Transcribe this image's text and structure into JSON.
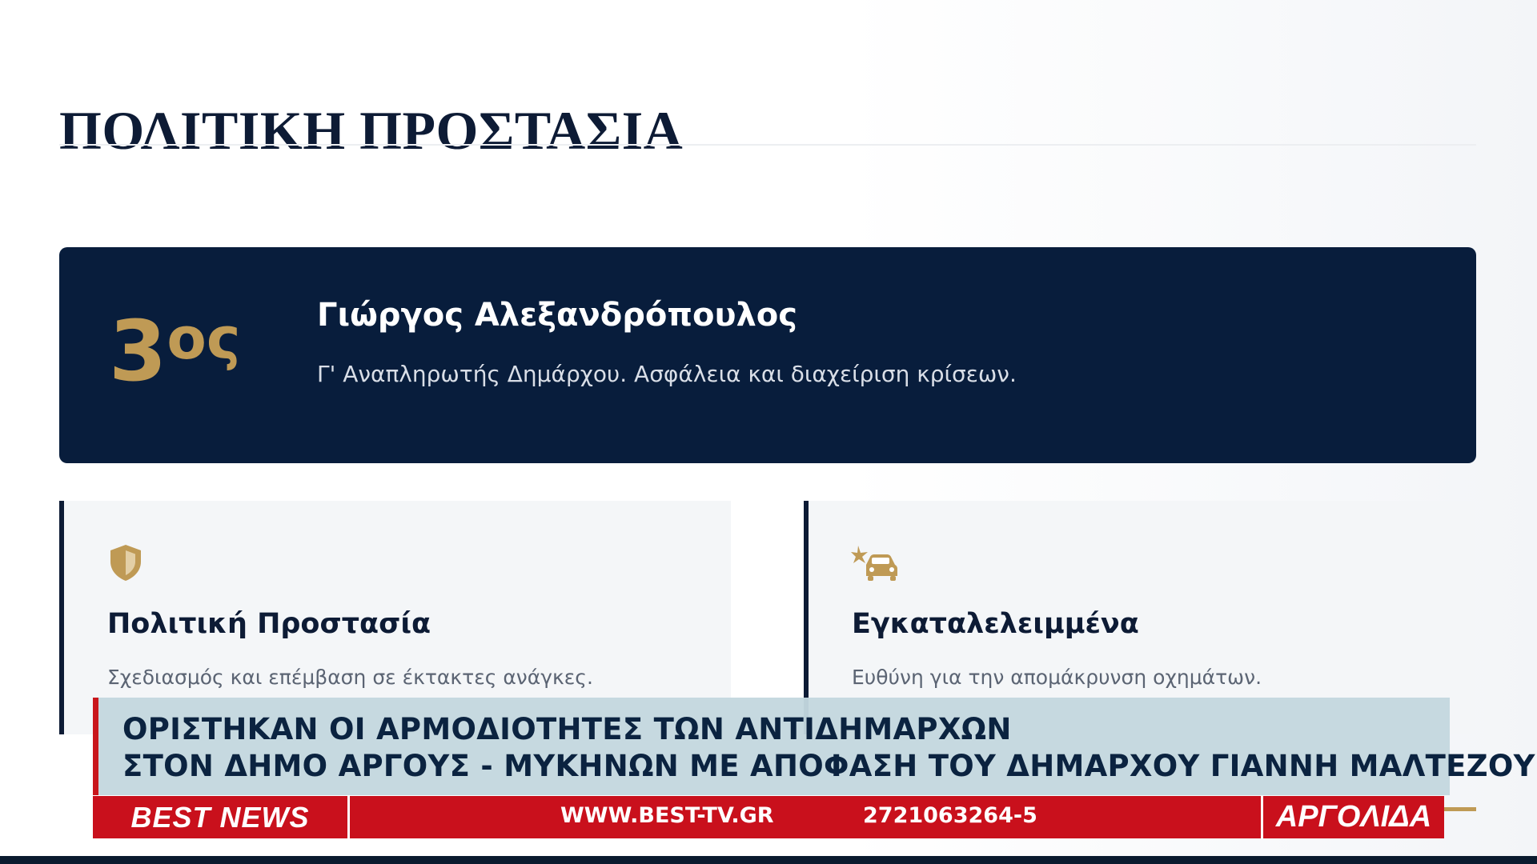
{
  "page": {
    "title": "ΠΟΛΙΤΙΚΗ ΠΡΟΣΤΑΣΙΑ"
  },
  "hero": {
    "rank_number": "3",
    "rank_suffix": "ος",
    "name": "Γιώργος Αλεξανδρόπουλος",
    "role": "Γ' Αναπληρωτής Δημάρχου. Ασφάλεια και διαχείριση κρίσεων."
  },
  "responsibilities": [
    {
      "icon": "shield-icon",
      "title": "Πολιτική Προστασία",
      "description": "Σχεδιασμός και επέμβαση σε έκτακτες ανάγκες."
    },
    {
      "icon": "car-crash-icon",
      "title": "Εγκαταλελειμμένα",
      "description": "Ευθύνη για την απομάκρυνση οχημάτων."
    }
  ],
  "news_ticker": {
    "headline_line1": "ΟΡΙΣΤΗΚΑΝ ΟΙ ΑΡΜΟΔΙΟΤΗΤΕΣ ΤΩΝ ΑΝΤΙΔΗΜΑΡΧΩΝ",
    "headline_line2": "ΣΤΟΝ ΔΗΜΟ ΑΡΓΟΥΣ - ΜΥΚΗΝΩΝ ΜΕ ΑΠΟΦΑΣΗ ΤΟΥ ΔΗΜΑΡΧΟΥ ΓΙΑΝΝΗ ΜΑΛΤΕΖΟΥ",
    "brand": "BEST NEWS",
    "website": "WWW.BEST-TV.GR",
    "phone": "2721063264-5",
    "region": "ΑΡΓΟΛΙΔΑ"
  },
  "colors": {
    "navy": "#081d3c",
    "gold": "#bf9a55",
    "ticker_red": "#c9101c",
    "headline_bg": "#c4d7df"
  }
}
